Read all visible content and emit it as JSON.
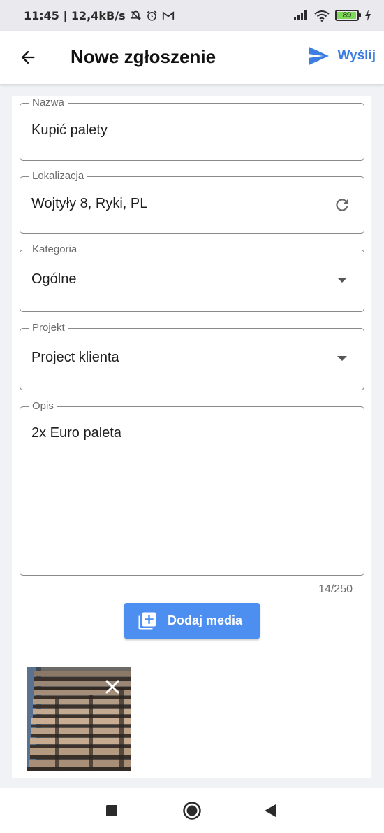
{
  "status_bar": {
    "time_speed": "11:45 | 12,4kB/s",
    "battery": "89",
    "icons": [
      "mute-icon",
      "alarm-icon",
      "gmail-icon",
      "signal-icon",
      "wifi-icon",
      "battery-icon",
      "charging-icon"
    ]
  },
  "app_bar": {
    "title": "Nowe zgłoszenie",
    "send_label": "Wyślij",
    "accent": "#3d7ee0"
  },
  "form": {
    "name": {
      "label": "Nazwa",
      "value": "Kupić palety"
    },
    "location": {
      "label": "Lokalizacja",
      "value": "Wojtyły 8, Ryki, PL",
      "icon": "refresh-icon"
    },
    "category": {
      "label": "Kategoria",
      "value": "Ogólne",
      "icon": "dropdown-arrow-icon"
    },
    "project": {
      "label": "Projekt",
      "value": "Project klienta",
      "icon": "dropdown-arrow-icon"
    },
    "description": {
      "label": "Opis",
      "value": "2x Euro paleta",
      "counter": "14/250"
    }
  },
  "media": {
    "button_label": "Dodaj media",
    "button_color": "#4c8ff0",
    "thumbnails": [
      {
        "name": "pallets-photo",
        "remove_icon": "close-icon"
      }
    ]
  },
  "nav_bar": {
    "buttons": [
      "recent-apps-icon",
      "home-icon",
      "back-icon"
    ]
  }
}
